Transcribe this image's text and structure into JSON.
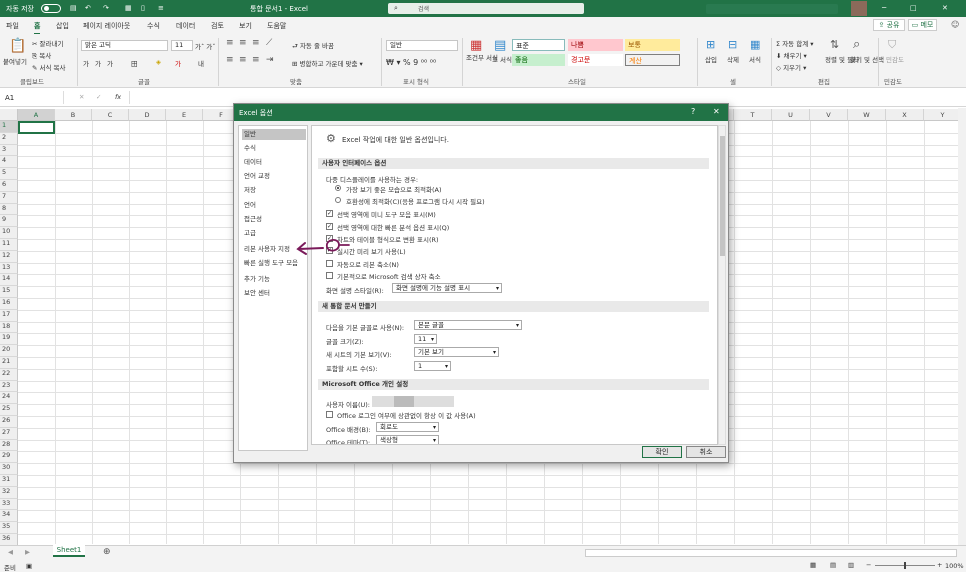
{
  "titlebar": {
    "autosave_label": "자동 저장",
    "autosave_state": "끔",
    "doc_title": "통합 문서1 - Excel",
    "search_placeholder": "검색",
    "minimize": "─",
    "restore": "□",
    "close": "✕"
  },
  "tabs": [
    "파일",
    "홈",
    "삽입",
    "페이지 레이아웃",
    "수식",
    "데이터",
    "검토",
    "보기",
    "도움말"
  ],
  "share_label": "공유",
  "memo_label": "메모",
  "ribbon": {
    "paste": "붙여넣기",
    "cut": "잘라내기",
    "copy": "복사",
    "format_painter": "서식 복사",
    "clipboard_group": "클립보드",
    "font_name": "맑은 고딕",
    "font_size": "11",
    "font_group": "글꼴",
    "wrap_text": "자동 줄 바꿈",
    "merge_center": "병합하고 가운데 맞춤",
    "align_group": "맞춤",
    "number_format": "일반",
    "number_group": "표시 형식",
    "cond_format": "조건부 서식",
    "format_table": "표 서식",
    "style_normal": "표준",
    "style_bad": "나쁨",
    "style_neutral": "보통",
    "style_good": "좋음",
    "style_warning": "경고문",
    "style_calc": "계산",
    "styles_group": "스타일",
    "insert": "삽입",
    "delete": "삭제",
    "format": "서식",
    "cells_group": "셀",
    "autosum": "자동 합계",
    "fill": "채우기",
    "clear": "지우기",
    "sort_filter": "정렬 및 필터",
    "find_select": "찾기 및 선택",
    "editing_group": "편집",
    "sensitivity": "민감도",
    "sensitivity_group": "민감도"
  },
  "formula_bar": {
    "name_box": "A1",
    "fx": "fx"
  },
  "columns": [
    "A",
    "B",
    "C",
    "D",
    "E",
    "F",
    "G",
    "H",
    "I",
    "J",
    "K",
    "L",
    "M",
    "N",
    "O",
    "P",
    "Q",
    "R",
    "S",
    "T",
    "U",
    "V",
    "W",
    "X",
    "Y"
  ],
  "rows": [
    "1",
    "2",
    "3",
    "4",
    "5",
    "6",
    "7",
    "8",
    "9",
    "10",
    "11",
    "12",
    "13",
    "14",
    "15",
    "16",
    "17",
    "18",
    "19",
    "20",
    "21",
    "22",
    "23",
    "24",
    "25",
    "26",
    "27",
    "28",
    "29",
    "30",
    "31",
    "32",
    "33",
    "34",
    "35",
    "36"
  ],
  "sheet_tab": "Sheet1",
  "status": {
    "ready": "준비",
    "zoom": "100%"
  },
  "dialog": {
    "title": "Excel 옵션",
    "help": "?",
    "close": "✕",
    "nav": [
      "일반",
      "수식",
      "데이터",
      "언어 교정",
      "저장",
      "언어",
      "접근성",
      "고급",
      "리본 사용자 지정",
      "빠른 실행 도구 모음",
      "추가 기능",
      "보안 센터"
    ],
    "header_text": "Excel 작업에 대한 일반 옵션입니다.",
    "sec_ui": "사용자 인터페이스 옵션",
    "multi_display": "다중 디스플레이를 사용하는 경우:",
    "opt_best_appearance": "가장 보기 좋은 모습으로 최적화(A)",
    "opt_compat": "호환성에 최적화(C)(응용 프로그램 다시 시작 필요)",
    "opt_mini_toolbar": "선택 영역에 미니 도구 모음 표시(M)",
    "opt_quick_analysis": "선택 영역에 대한 빠른 분석 옵션 표시(Q)",
    "opt_chart_filter": "차트와 테이블 형식으로 변환 표시(R)",
    "opt_live_preview": "실시간 미리 보기 사용(L)",
    "opt_collapse_ribbon": "자동으로 리본 축소(N)",
    "opt_collapse_search": "기본적으로 Microsoft 검색 상자 축소",
    "screentip_label": "화면 설명 스타일(R):",
    "screentip_value": "화면 설명에 기능 설명 표시",
    "sec_new_wb": "새 통합 문서 만들기",
    "default_font_label": "다음을 기본 글꼴로 사용(N):",
    "default_font_value": "본문 글꼴",
    "font_size_label": "글꼴 크기(Z):",
    "font_size_value": "11",
    "default_view_label": "새 시트의 기본 보기(V):",
    "default_view_value": "기본 보기",
    "sheet_count_label": "포함할 시트 수(S):",
    "sheet_count_value": "1",
    "sec_personalize": "Microsoft Office 개인 설정",
    "username_label": "사용자 이름(U):",
    "always_use": "Office 로그인 여부에 상관없이 항상 이 값 사용(A)",
    "bg_label": "Office 배경(B):",
    "bg_value": "회로도",
    "theme_label": "Office 테마(T):",
    "theme_value": "색상형",
    "ok": "확인",
    "cancel": "취소"
  },
  "colors": {
    "accent": "#217346",
    "annotation": "#7a1a5a"
  }
}
